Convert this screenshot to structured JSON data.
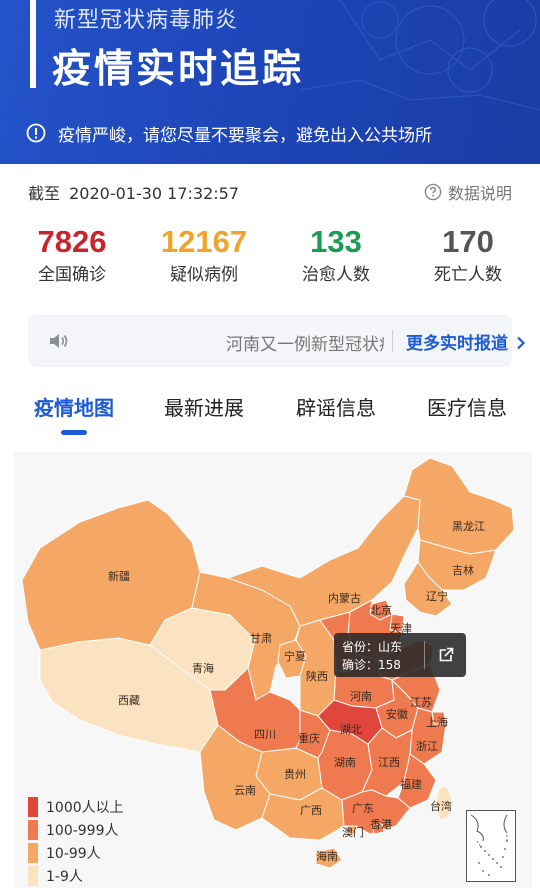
{
  "header": {
    "subtitle": "新型冠状病毒肺炎",
    "title": "疫情实时追踪",
    "notice": "疫情严峻，请您尽量不要聚会，避免出入公共场所",
    "background_color": "#1f49bd"
  },
  "updated": {
    "label": "截至",
    "datetime": "2020-01-30 17:32:57",
    "data_note": "数据说明"
  },
  "stats": [
    {
      "value": "7826",
      "label": "全国确诊",
      "color": "#c8252c"
    },
    {
      "value": "12167",
      "label": "疑似病例",
      "color": "#f0a52a"
    },
    {
      "value": "133",
      "label": "治愈人数",
      "color": "#1f9a55"
    },
    {
      "value": "170",
      "label": "死亡人数",
      "color": "#555555"
    }
  ],
  "ticker": {
    "news": "河南又一例新型冠状病毒",
    "more_label": "更多实时报道",
    "icon": "speaker-icon"
  },
  "tabs": [
    {
      "label": "疫情地图",
      "active": true
    },
    {
      "label": "最新进展",
      "active": false
    },
    {
      "label": "辟谣信息",
      "active": false
    },
    {
      "label": "医疗信息",
      "active": false
    }
  ],
  "map": {
    "provinces": {
      "xinjiang": "新疆",
      "xizang": "西藏",
      "qinghai": "青海",
      "gansu": "甘肃",
      "neimenggu": "内蒙古",
      "heilongjiang": "黑龙江",
      "jilin": "吉林",
      "liaoning": "辽宁",
      "beijing": "北京",
      "tianjin": "天津",
      "ningxia": "宁夏",
      "shaanxi": "陕西",
      "henan": "河南",
      "jiangsu": "江苏",
      "anhui": "安徽",
      "hubei": "湖北",
      "sichuan": "四川",
      "chongqing": "重庆",
      "shanghai": "上海",
      "zhejiang": "浙江",
      "hunan": "湖南",
      "jiangxi": "江西",
      "guizhou": "贵州",
      "yunnan": "云南",
      "guangxi": "广西",
      "guangdong": "广东",
      "fujian": "福建",
      "taiwan": "台湾",
      "xianggang": "香港",
      "aomen": "澳门",
      "hainan": "海南"
    },
    "tooltip": {
      "province_label": "省份：山东",
      "confirmed_label": "确诊：158"
    },
    "legend": [
      {
        "label": "1000人以上",
        "color": "#e0463c"
      },
      {
        "label": "100-999人",
        "color": "#f07a50"
      },
      {
        "label": "10-99人",
        "color": "#f5a866"
      },
      {
        "label": "1-9人",
        "color": "#fbe3c1"
      }
    ]
  }
}
